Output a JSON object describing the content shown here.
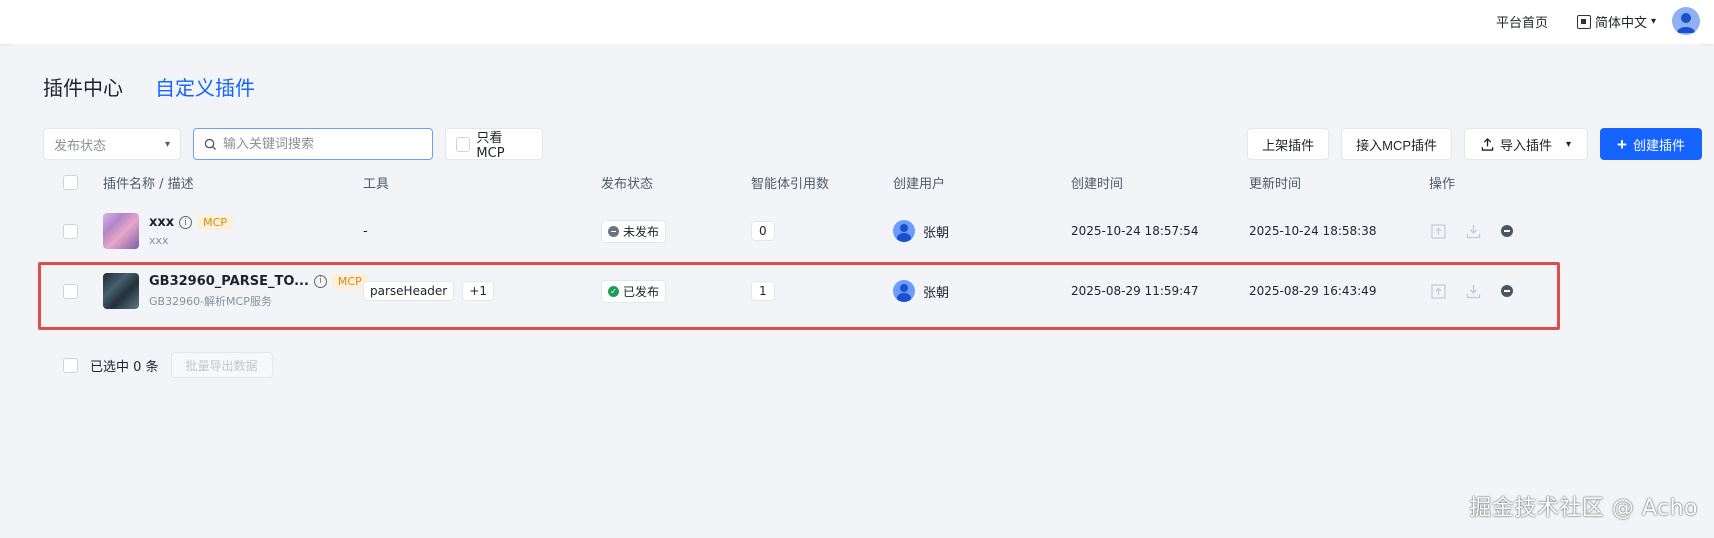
{
  "topbar": {
    "home_label": "平台首页",
    "lang_label": "简体中文"
  },
  "tabs": [
    {
      "label": "插件中心",
      "active": false
    },
    {
      "label": "自定义插件",
      "active": true
    }
  ],
  "filters": {
    "status_placeholder": "发布状态",
    "search_placeholder": "输入关键词搜索",
    "mcp_only_label": "只看 MCP"
  },
  "actions": {
    "list_label": "上架插件",
    "connect_mcp_label": "接入MCP插件",
    "import_label": "导入插件",
    "create_label": "创建插件"
  },
  "columns": {
    "name": "插件名称 / 描述",
    "tool": "工具",
    "status": "发布状态",
    "refs": "智能体引用数",
    "user": "创建用户",
    "created": "创建时间",
    "updated": "更新时间",
    "ops": "操作"
  },
  "rows": [
    {
      "name": "xxx",
      "badge": "MCP",
      "desc": "xxx",
      "tool": "-",
      "status": "未发布",
      "refs": "0",
      "user": "张朝",
      "created": "2025-10-24 18:57:54",
      "updated": "2025-10-24 18:58:38"
    },
    {
      "name": "GB32960_PARSE_TO...",
      "badge": "MCP",
      "desc": "GB32960-解析MCP服务",
      "tool": "parseHeader",
      "tool_more": "+1",
      "status": "已发布",
      "refs": "1",
      "user": "张朝",
      "created": "2025-08-29 11:59:47",
      "updated": "2025-08-29 16:43:49"
    }
  ],
  "footer": {
    "selected_text": "已选中 0 条",
    "export_label": "批量导出数据"
  },
  "watermark": "掘金技术社区 @ Acho",
  "colors": {
    "accent": "#1664ff",
    "highlight": "#e14b4b",
    "mcp_badge_bg": "#fdf0d8",
    "mcp_badge_text": "#d58a14",
    "published": "#1f9d55"
  }
}
